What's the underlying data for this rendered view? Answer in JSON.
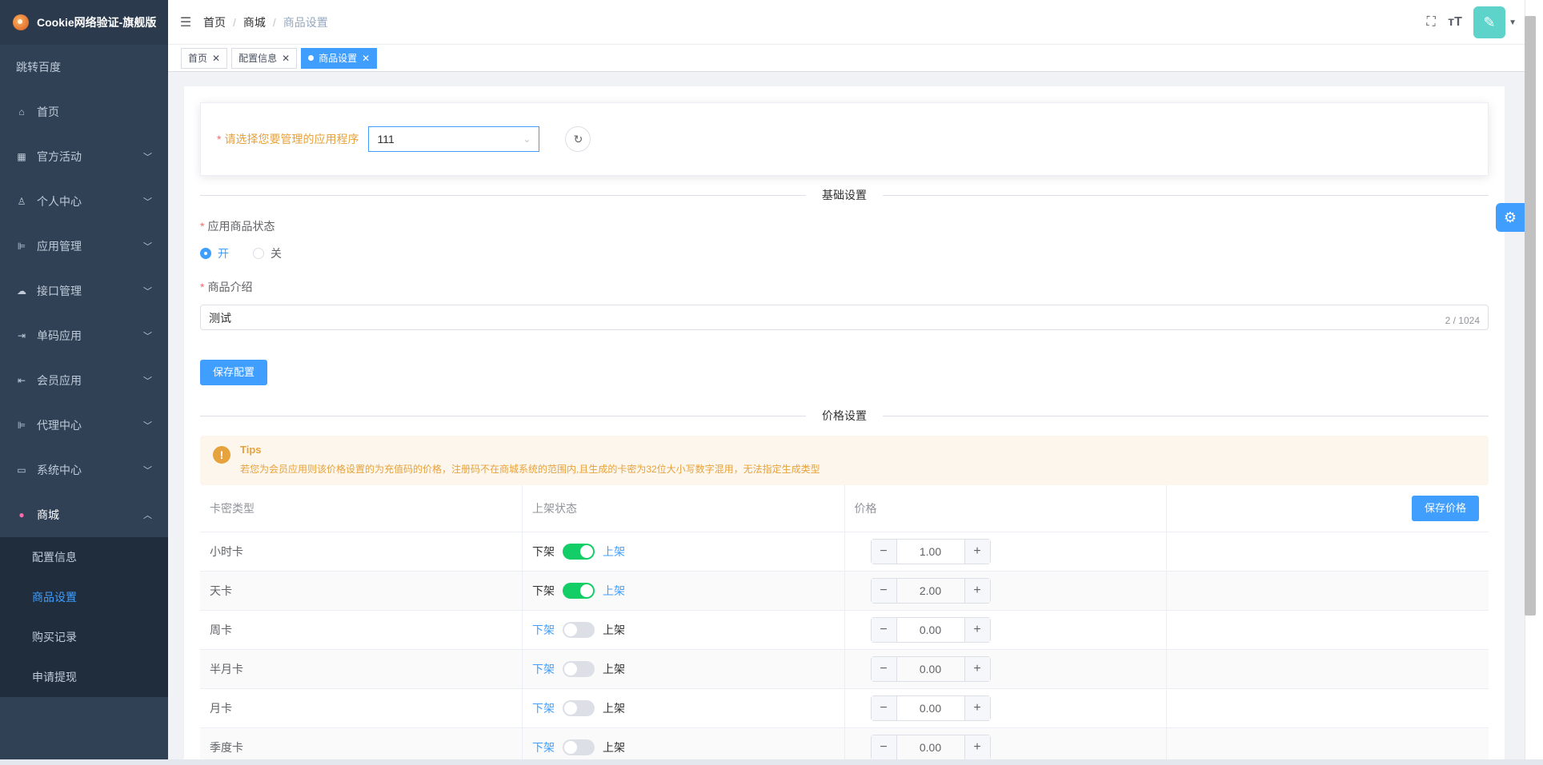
{
  "app": {
    "title": "Cookie网络验证-旗舰版"
  },
  "sidebar": {
    "jump": "跳转百度",
    "items": [
      {
        "label": "首页",
        "icon": "home-icon",
        "glyph": "⌂",
        "expandable": false
      },
      {
        "label": "官方活动",
        "icon": "grid-icon",
        "glyph": "▦",
        "expandable": true
      },
      {
        "label": "个人中心",
        "icon": "user-icon",
        "glyph": "♙",
        "expandable": true
      },
      {
        "label": "应用管理",
        "icon": "tree-icon",
        "glyph": "⊫",
        "expandable": true
      },
      {
        "label": "接口管理",
        "icon": "cloud-icon",
        "glyph": "☁",
        "expandable": true
      },
      {
        "label": "单码应用",
        "icon": "login-icon",
        "glyph": "⇥",
        "expandable": true
      },
      {
        "label": "会员应用",
        "icon": "logout-icon",
        "glyph": "⇤",
        "expandable": true
      },
      {
        "label": "代理中心",
        "icon": "tree-icon",
        "glyph": "⊫",
        "expandable": true
      },
      {
        "label": "系统中心",
        "icon": "monitor-icon",
        "glyph": "▭",
        "expandable": true
      },
      {
        "label": "商城",
        "icon": "shop-icon",
        "glyph": "●",
        "expandable": true,
        "open": true
      }
    ],
    "submenu": [
      "配置信息",
      "商品设置",
      "购买记录",
      "申请提现"
    ],
    "active_sub": "商品设置"
  },
  "header": {
    "breadcrumb": [
      "首页",
      "商城",
      "商品设置"
    ]
  },
  "tags": [
    {
      "label": "首页",
      "active": false
    },
    {
      "label": "配置信息",
      "active": false
    },
    {
      "label": "商品设置",
      "active": true
    }
  ],
  "app_select": {
    "label": "请选择您要管理的应用程序",
    "value": "111"
  },
  "basic": {
    "title": "基础设置",
    "status_label": "应用商品状态",
    "radio_on": "开",
    "radio_off": "关",
    "intro_label": "商品介绍",
    "intro_value": "测试",
    "intro_count": "2 / 1024",
    "save_btn": "保存配置"
  },
  "price": {
    "title": "价格设置",
    "tips_title": "Tips",
    "tips_text": "若您为会员应用则该价格设置的为充值码的价格，注册码不在商城系统的范围内,且生成的卡密为32位大小写数字混用，无法指定生成类型",
    "columns": [
      "卡密类型",
      "上架状态",
      "价格",
      ""
    ],
    "save_btn": "保存价格",
    "off_label": "下架",
    "on_label": "上架",
    "rows": [
      {
        "type": "小时卡",
        "on": true,
        "price": "1.00"
      },
      {
        "type": "天卡",
        "on": true,
        "price": "2.00"
      },
      {
        "type": "周卡",
        "on": false,
        "price": "0.00"
      },
      {
        "type": "半月卡",
        "on": false,
        "price": "0.00"
      },
      {
        "type": "月卡",
        "on": false,
        "price": "0.00"
      },
      {
        "type": "季度卡",
        "on": false,
        "price": "0.00"
      }
    ]
  }
}
